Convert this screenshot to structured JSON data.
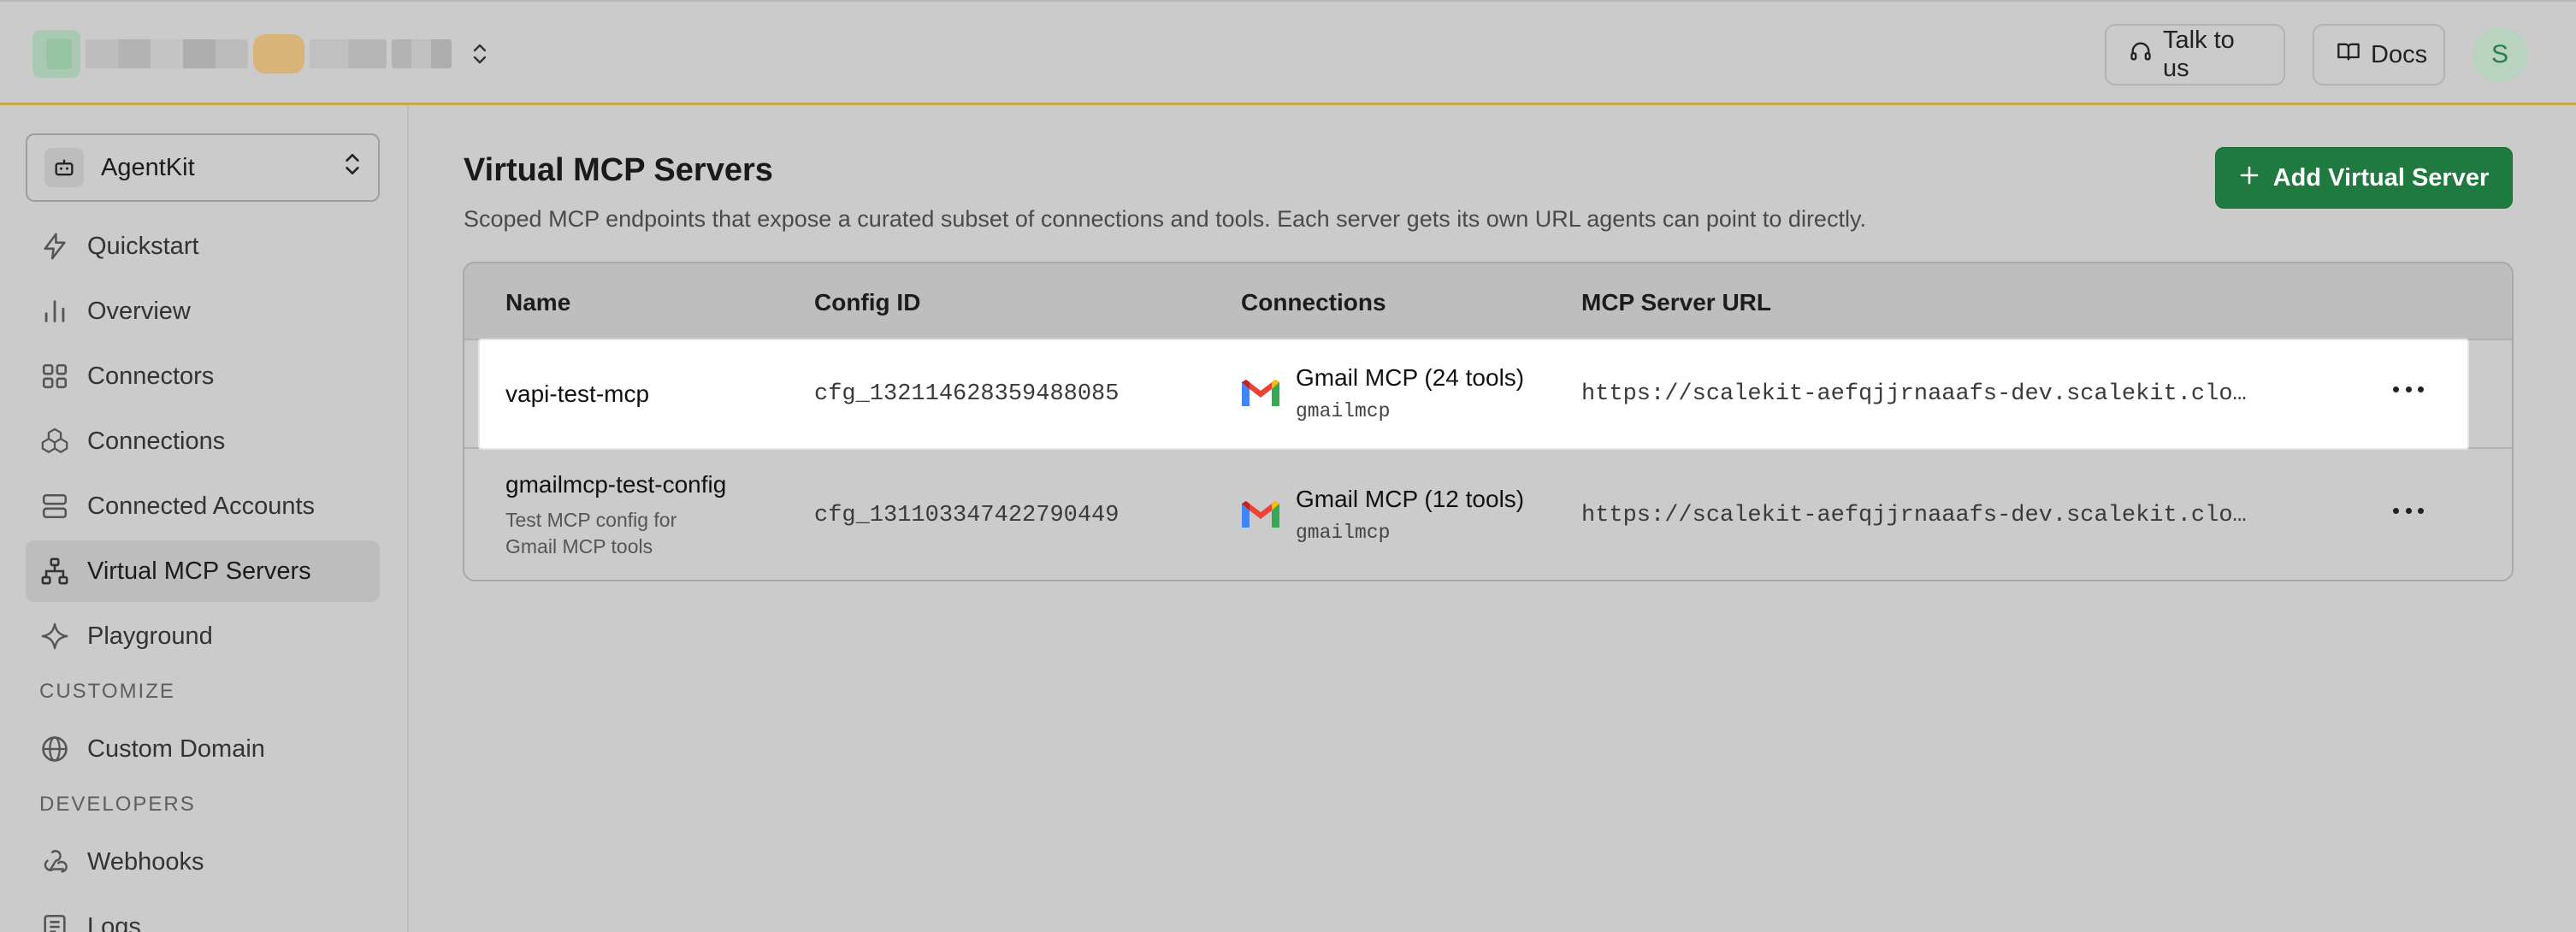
{
  "topbar": {
    "talk_label": "Talk to us",
    "docs_label": "Docs",
    "avatar_initial": "S"
  },
  "sidebar": {
    "product": "AgentKit",
    "items": [
      {
        "label": "Quickstart",
        "icon": "lightning-icon"
      },
      {
        "label": "Overview",
        "icon": "bar-chart-icon"
      },
      {
        "label": "Connectors",
        "icon": "grid-icon"
      },
      {
        "label": "Connections",
        "icon": "cubes-icon"
      },
      {
        "label": "Connected Accounts",
        "icon": "accounts-icon"
      },
      {
        "label": "Virtual MCP Servers",
        "icon": "network-icon",
        "active": true
      },
      {
        "label": "Playground",
        "icon": "sparkle-icon"
      }
    ],
    "customize_label": "CUSTOMIZE",
    "customize_items": [
      {
        "label": "Custom Domain",
        "icon": "globe-icon"
      }
    ],
    "developers_label": "DEVELOPERS",
    "developer_items": [
      {
        "label": "Webhooks",
        "icon": "webhook-icon"
      },
      {
        "label": "Logs",
        "icon": "logs-icon"
      }
    ]
  },
  "main": {
    "title": "Virtual MCP Servers",
    "subtitle": "Scoped MCP endpoints that expose a curated subset of connections and tools. Each server gets its own URL agents can point to directly.",
    "add_button": "Add Virtual Server",
    "table": {
      "headers": [
        "Name",
        "Config ID",
        "Connections",
        "MCP Server URL"
      ],
      "rows": [
        {
          "name": "vapi-test-mcp",
          "description": "",
          "config_id": "cfg_132114628359488085",
          "connection_title": "Gmail MCP (24 tools)",
          "connection_sub": "gmailmcp",
          "url": "https://scalekit-aefqjjrnaaafs-dev.scalekit.clo…"
        },
        {
          "name": "gmailmcp-test-config",
          "description_line1": "Test MCP config for",
          "description_line2": "Gmail MCP tools",
          "config_id": "cfg_131103347422790449",
          "connection_title": "Gmail MCP (12 tools)",
          "connection_sub": "gmailmcp",
          "url": "https://scalekit-aefqjjrnaaafs-dev.scalekit.clo…"
        }
      ]
    }
  },
  "colors": {
    "accent": "#1f7a3f",
    "background": "#cbcbcb",
    "topbar_border": "#c9a84a"
  }
}
